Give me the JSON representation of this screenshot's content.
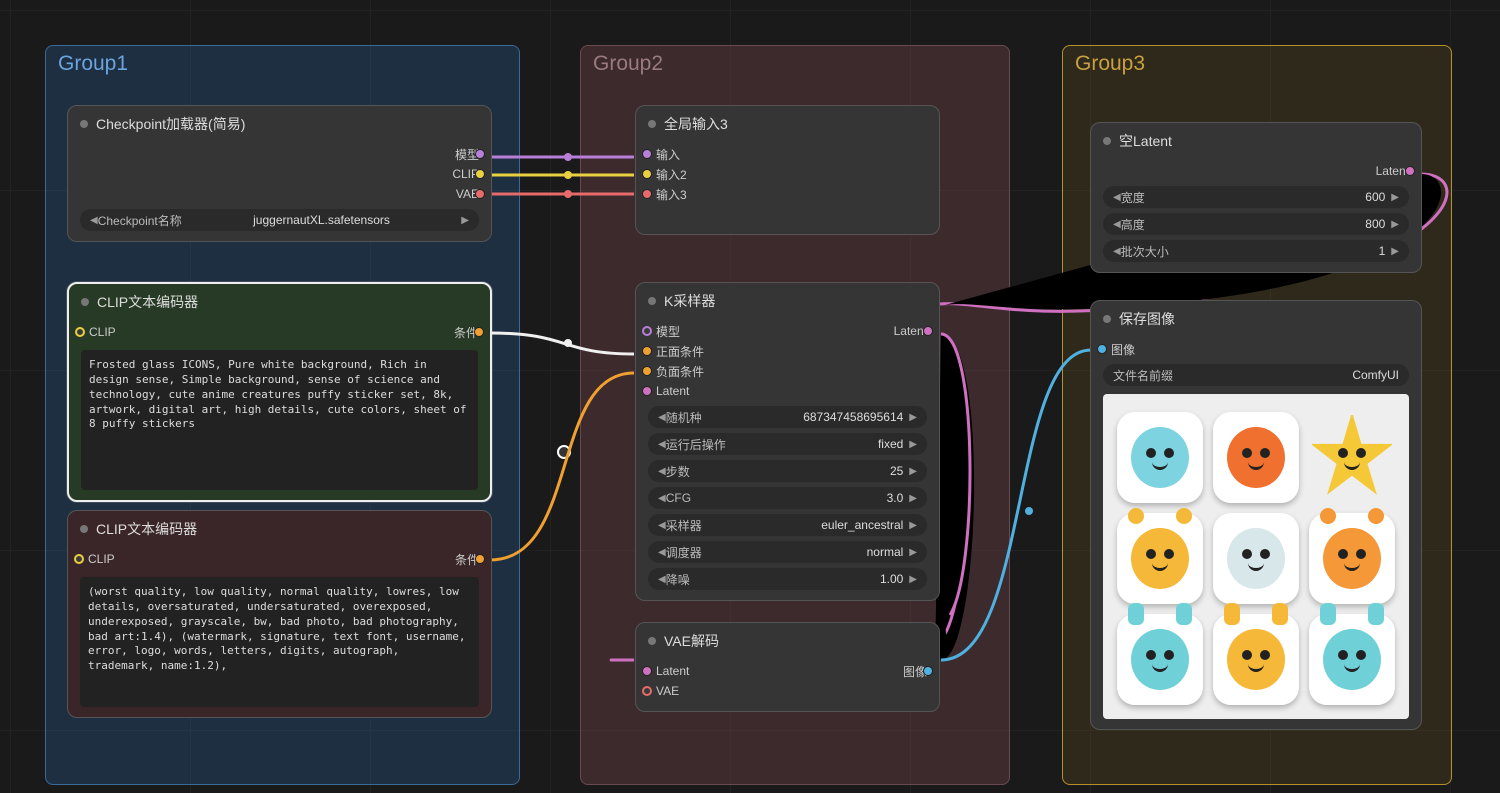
{
  "groups": {
    "g1": {
      "title": "Group1"
    },
    "g2": {
      "title": "Group2"
    },
    "g3": {
      "title": "Group3"
    }
  },
  "nodes": {
    "checkpoint": {
      "title": "Checkpoint加载器(简易)",
      "outputs": {
        "model": "模型",
        "clip": "CLIP",
        "vae": "VAE"
      },
      "widget": {
        "label": "Checkpoint名称",
        "value": "juggernautXL.safetensors"
      }
    },
    "clip_pos": {
      "title": "CLIP文本编码器",
      "input": "CLIP",
      "output": "条件",
      "text": "Frosted glass ICONS, Pure white background, Rich in design sense, Simple background, sense of science and technology, cute anime creatures puffy sticker set, 8k, artwork, digital art, high details, cute colors, sheet of 8 puffy stickers"
    },
    "clip_neg": {
      "title": "CLIP文本编码器",
      "input": "CLIP",
      "output": "条件",
      "text": "(worst quality, low quality, normal quality, lowres, low details, oversaturated, undersaturated, overexposed, underexposed, grayscale, bw, bad photo, bad photography, bad art:1.4), (watermark, signature, text font, username, error, logo, words, letters, digits, autograph, trademark, name:1.2),"
    },
    "reroute": {
      "title": "全局输入3",
      "inputs": {
        "in1": "输入",
        "in2": "输入2",
        "in3": "输入3"
      }
    },
    "ksampler": {
      "title": "K采样器",
      "inputs": {
        "model": "模型",
        "pos": "正面条件",
        "neg": "负面条件",
        "latent": "Latent"
      },
      "output": "Latent",
      "widgets": {
        "seed": {
          "label": "随机种",
          "value": "687347458695614"
        },
        "control": {
          "label": "运行后操作",
          "value": "fixed"
        },
        "steps": {
          "label": "步数",
          "value": "25"
        },
        "cfg": {
          "label": "CFG",
          "value": "3.0"
        },
        "sampler": {
          "label": "采样器",
          "value": "euler_ancestral"
        },
        "sched": {
          "label": "调度器",
          "value": "normal"
        },
        "denoise": {
          "label": "降噪",
          "value": "1.00"
        }
      }
    },
    "vae_decode": {
      "title": "VAE解码",
      "inputs": {
        "latent": "Latent",
        "vae": "VAE"
      },
      "output": "图像"
    },
    "empty_latent": {
      "title": "空Latent",
      "output": "Latent",
      "widgets": {
        "width": {
          "label": "宽度",
          "value": "600"
        },
        "height": {
          "label": "高度",
          "value": "800"
        },
        "batch": {
          "label": "批次大小",
          "value": "1"
        }
      }
    },
    "save_image": {
      "title": "保存图像",
      "input": "图像",
      "widget": {
        "label": "文件名前缀",
        "value": "ComfyUI"
      }
    }
  },
  "colors": {
    "model": "#b87fd8",
    "clip": "#e8d040",
    "vae": "#e86b6b",
    "cond": "#f0a030",
    "latent": "#d070c0",
    "image": "#50b0e0",
    "white": "#f0f0f0"
  }
}
